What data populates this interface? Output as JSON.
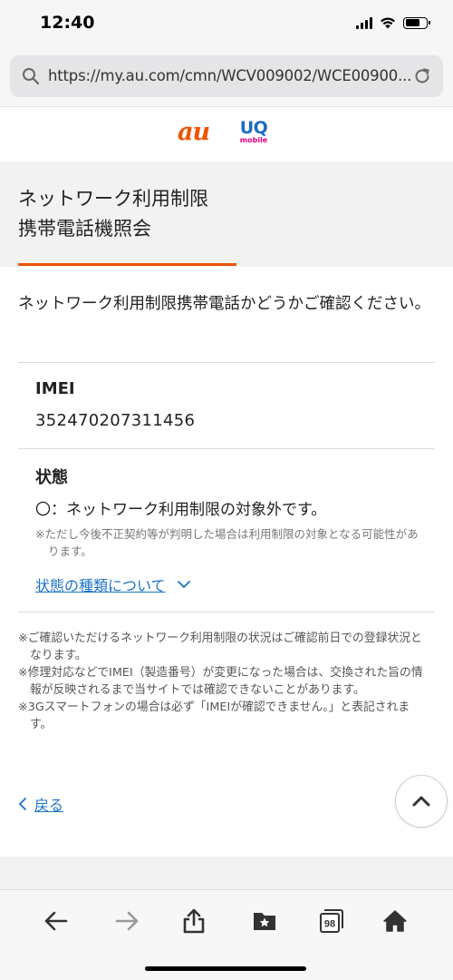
{
  "status_bar": {
    "time": "12:40"
  },
  "browser": {
    "url": "https://my.au.com/cmn/WCV009002/WCE00900..."
  },
  "logos": {
    "au": "au",
    "uq_top": "UQ",
    "uq_bottom": "mobile"
  },
  "page": {
    "title_line1": "ネットワーク利用制限",
    "title_line2": "携帯電話機照会",
    "intro": "ネットワーク利用制限携帯電話かどうかご確認ください。"
  },
  "imei": {
    "label": "IMEI",
    "value": "352470207311456"
  },
  "state": {
    "label": "状態",
    "text": "〇：ネットワーク利用制限の対象外です。",
    "note": "※ただし今後不正契約等が判明した場合は利用制限の対象となる可能性があります。",
    "link_label": "状態の種類について"
  },
  "footnotes": [
    "※ご確認いただけるネットワーク利用制限の状況はご確認前日での登録状況となります。",
    "※修理対応などでIMEI（製造番号）が変更になった場合は、交換された旨の情報が反映されるまで当サイトでは確認できないことがあります。",
    "※3Gスマートフォンの場合は必ず「IMEIが確認できません。」と表記されます。"
  ],
  "nav": {
    "back_label": "戻る"
  },
  "toolbar": {
    "tabs_count": "98"
  },
  "colors": {
    "accent": "#eb5505",
    "link": "#1c73c9",
    "uq_blue": "#1e6bc2",
    "uq_pink": "#e4007f"
  }
}
